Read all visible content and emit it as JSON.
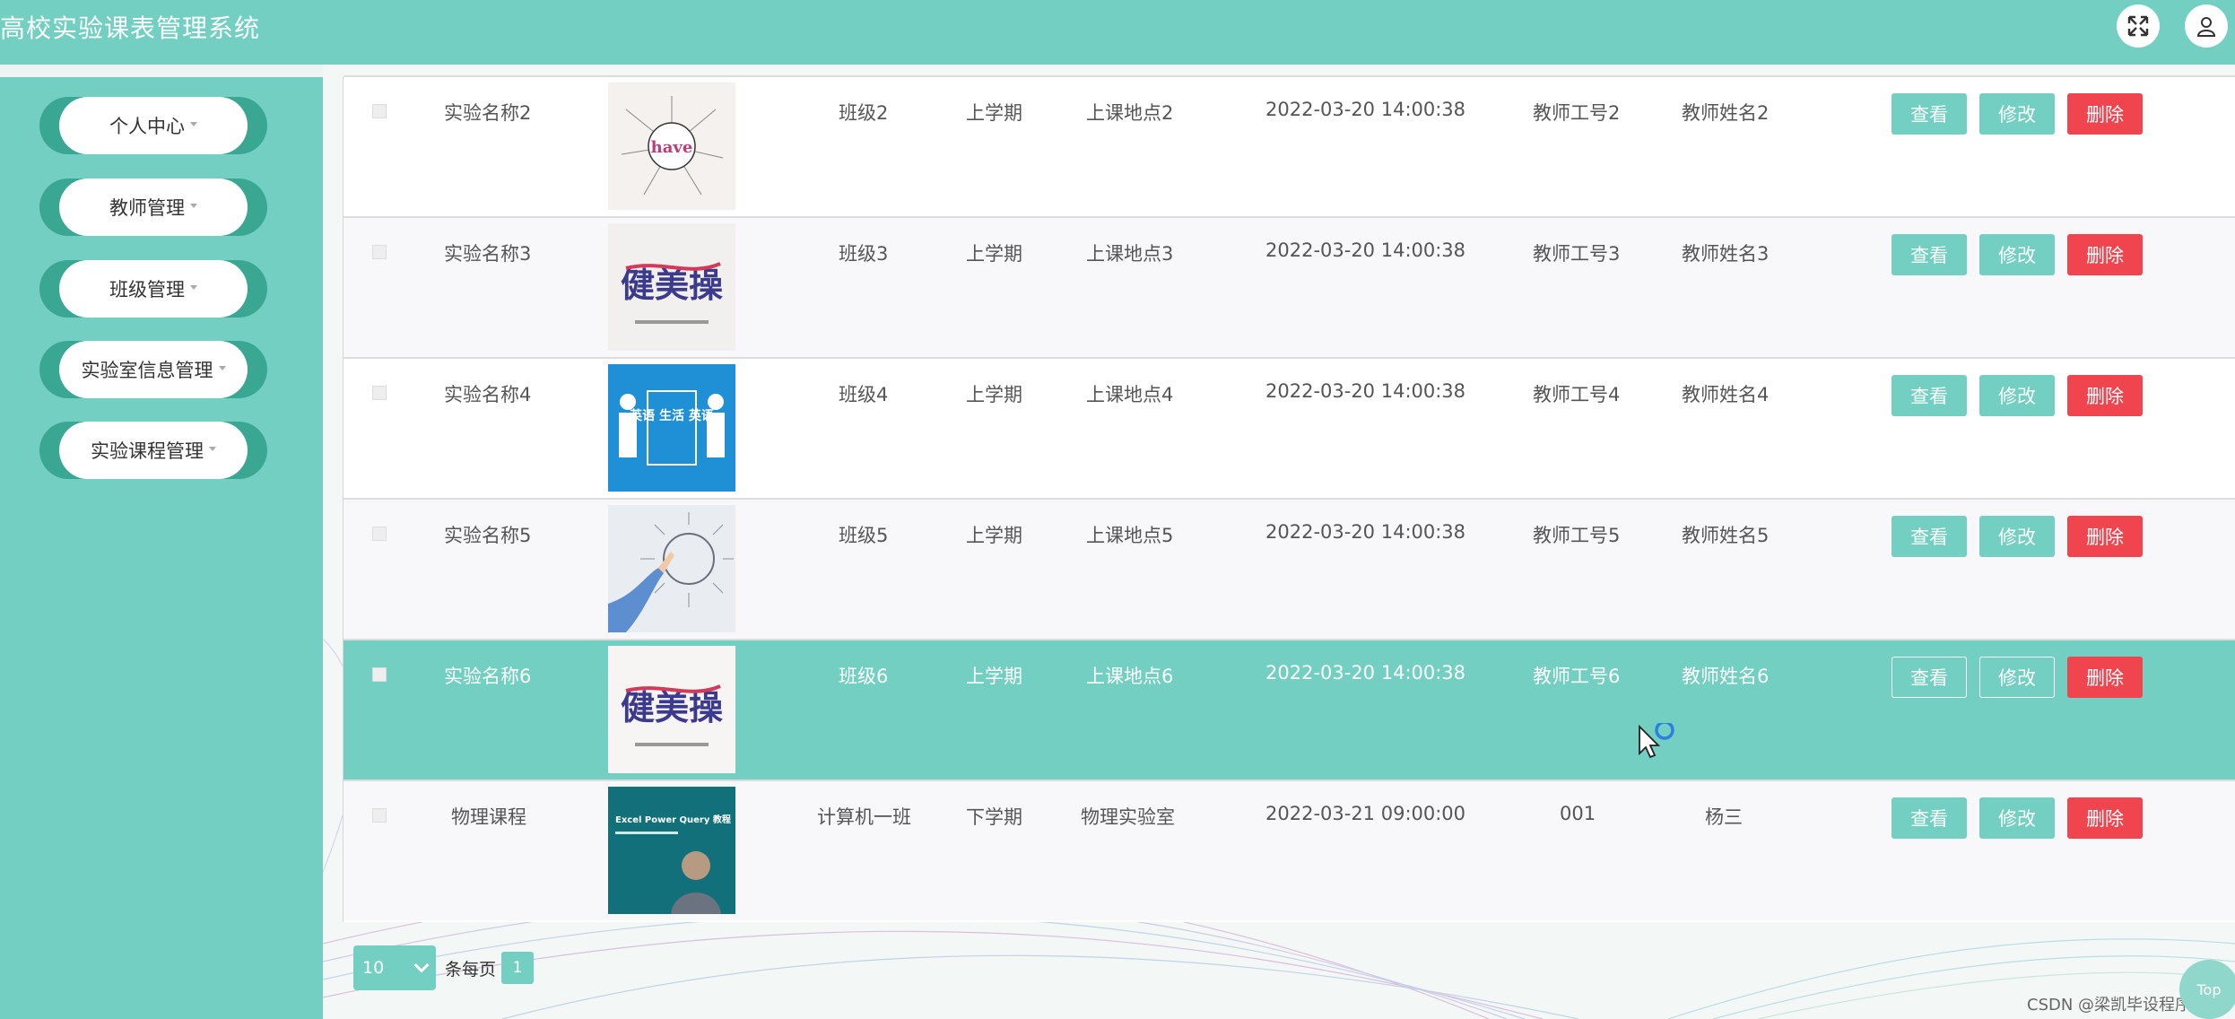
{
  "app": {
    "title": "高校实验课表管理系统"
  },
  "header": {
    "icons": [
      "fullscreen-icon",
      "user-icon"
    ]
  },
  "sidebar": {
    "items": [
      {
        "label": "个人中心"
      },
      {
        "label": "教师管理"
      },
      {
        "label": "班级管理"
      },
      {
        "label": "实验室信息管理"
      },
      {
        "label": "实验课程管理"
      }
    ]
  },
  "table": {
    "rows": [
      {
        "name": "实验名称2",
        "class": "班级2",
        "term": "上学期",
        "location": "上课地点2",
        "time": "2022-03-20 14:00:38",
        "teacher_id": "教师工号2",
        "teacher_name": "教师姓名2",
        "thumb_text": "have"
      },
      {
        "name": "实验名称3",
        "class": "班级3",
        "term": "上学期",
        "location": "上课地点3",
        "time": "2022-03-20 14:00:38",
        "teacher_id": "教师工号3",
        "teacher_name": "教师姓名3",
        "thumb_text": "健美操"
      },
      {
        "name": "实验名称4",
        "class": "班级4",
        "term": "上学期",
        "location": "上课地点4",
        "time": "2022-03-20 14:00:38",
        "teacher_id": "教师工号4",
        "teacher_name": "教师姓名4",
        "thumb_text": "英语 生活 英语"
      },
      {
        "name": "实验名称5",
        "class": "班级5",
        "term": "上学期",
        "location": "上课地点5",
        "time": "2022-03-20 14:00:38",
        "teacher_id": "教师工号5",
        "teacher_name": "教师姓名5",
        "thumb_text": ""
      },
      {
        "name": "实验名称6",
        "class": "班级6",
        "term": "上学期",
        "location": "上课地点6",
        "time": "2022-03-20 14:00:38",
        "teacher_id": "教师工号6",
        "teacher_name": "教师姓名6",
        "thumb_text": "健美操"
      },
      {
        "name": "物理课程",
        "class": "计算机一班",
        "term": "下学期",
        "location": "物理实验室",
        "time": "2022-03-21 09:00:00",
        "teacher_id": "001",
        "teacher_name": "杨三",
        "thumb_text": "Excel Power Query 教程"
      }
    ],
    "actions": {
      "view": "查看",
      "edit": "修改",
      "delete": "删除"
    }
  },
  "pagination": {
    "page_size": "10",
    "per_page_label": "条每页",
    "current_page": "1"
  },
  "footer": {
    "watermark": "CSDN @梁凯毕设程序",
    "top_label": "Top"
  },
  "colors": {
    "accent": "#72cfc1",
    "danger": "#f0454f",
    "sidebar_dark": "#3aa792"
  }
}
